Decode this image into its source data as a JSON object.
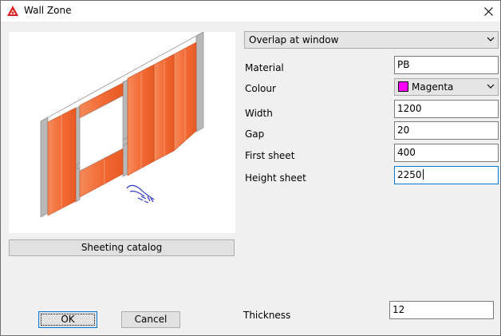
{
  "window": {
    "title": "Wall Zone",
    "icons": {
      "app": "app-logo-icon",
      "close": "close-icon"
    }
  },
  "overlap": {
    "value": "Overlap at window"
  },
  "fields": {
    "material": {
      "label": "Material",
      "value": "PB"
    },
    "colour": {
      "label": "Colour",
      "value": "Magenta",
      "swatch_color": "#ff00ff"
    },
    "width": {
      "label": "Width",
      "value": "1200"
    },
    "gap": {
      "label": "Gap",
      "value": "20"
    },
    "first_sheet": {
      "label": "First sheet",
      "value": "400"
    },
    "height_sheet": {
      "label": "Height sheet",
      "value": "2250"
    },
    "thickness": {
      "label": "Thickness",
      "value": "12"
    }
  },
  "buttons": {
    "catalog": "Sheeting catalog",
    "ok": "OK",
    "cancel": "Cancel"
  },
  "preview": {
    "panel_color": "#f26b36",
    "frame_color": "#b4b4b4",
    "annotation_color": "#2b35c9"
  }
}
